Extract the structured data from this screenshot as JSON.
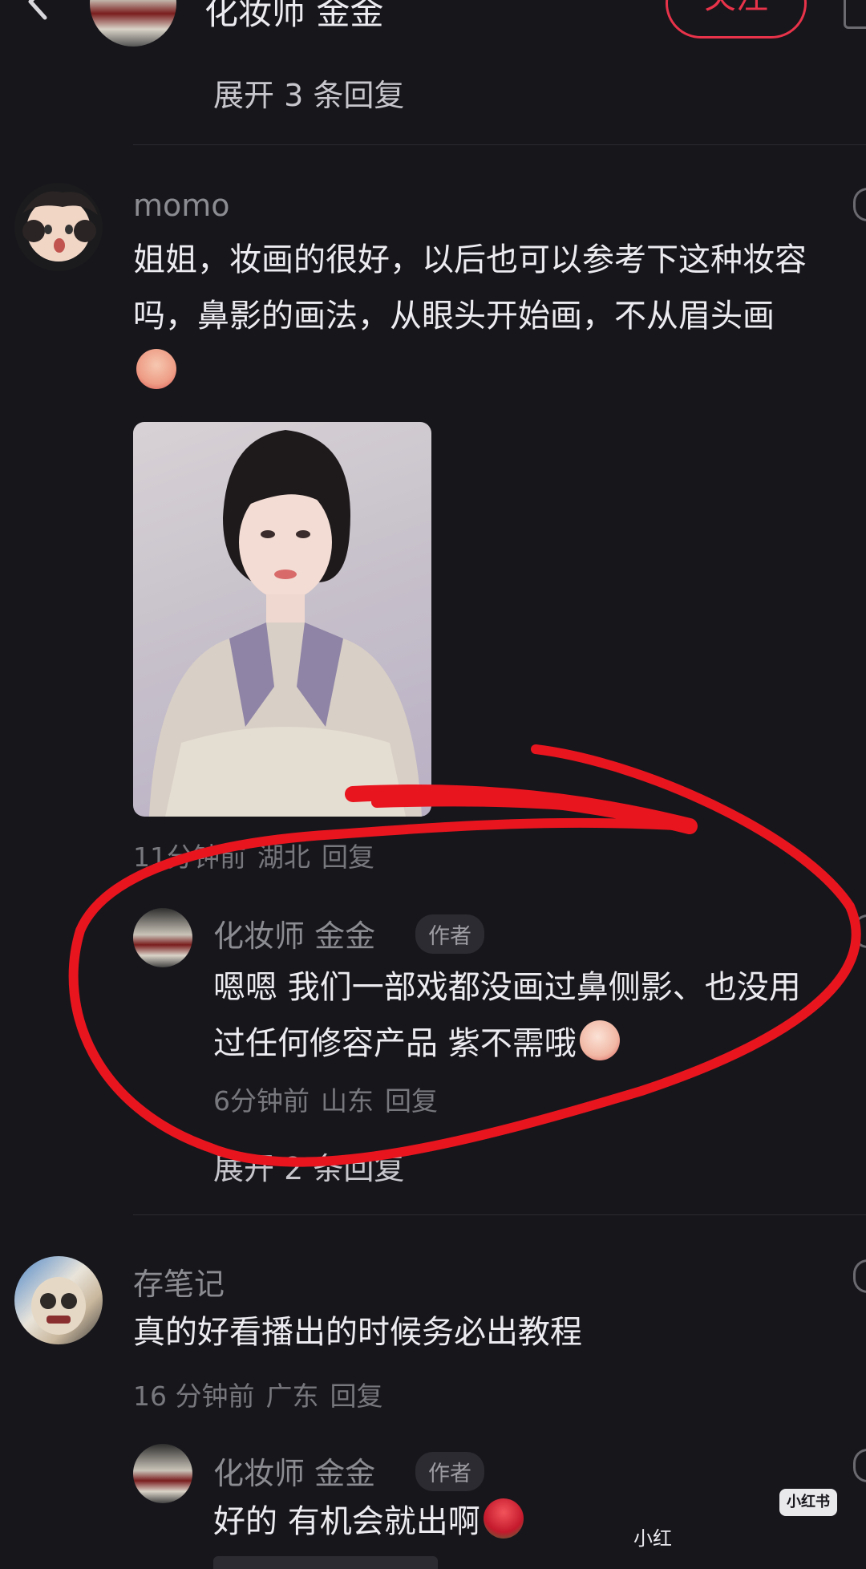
{
  "header": {
    "back_icon": "chevron-left-icon",
    "author_name": "化妆师 金金",
    "follow_label": "关注",
    "expand_replies": "展开 3 条回复"
  },
  "comments": [
    {
      "user": "momo",
      "text": "姐姐，妆画的很好，以后也可以参考下这种妆容吗，鼻影的画法，从眼头开始画，不从眉头画",
      "emoji": "pleading-emoji",
      "has_image": true,
      "time": "11分钟前",
      "location": "湖北",
      "reply_label": "回复",
      "reply": {
        "user": "化妆师 金金",
        "badge": "作者",
        "text": "嗯嗯  我们一部戏都没画过鼻侧影、也没用过任何修容产品   紫不需哦",
        "emoji": "blushing-emoji",
        "time": "6分钟前",
        "location": "山东",
        "reply_label": "回复"
      },
      "expand_replies": "展开 2 条回复"
    },
    {
      "user": "存笔记",
      "text": "真的好看播出的时候务必出教程",
      "time": "16 分钟前",
      "location": "广东",
      "reply_label": "回复",
      "reply": {
        "user": "化妆师 金金",
        "badge": "作者",
        "text": "好的 有机会就出啊",
        "emoji": "rose-emoji"
      }
    }
  ],
  "watermark": {
    "logo": "小红书",
    "text": "小红"
  },
  "colors": {
    "background": "#17161b",
    "follow_accent": "#e8334a",
    "annotation_circle": "#e8151f"
  }
}
